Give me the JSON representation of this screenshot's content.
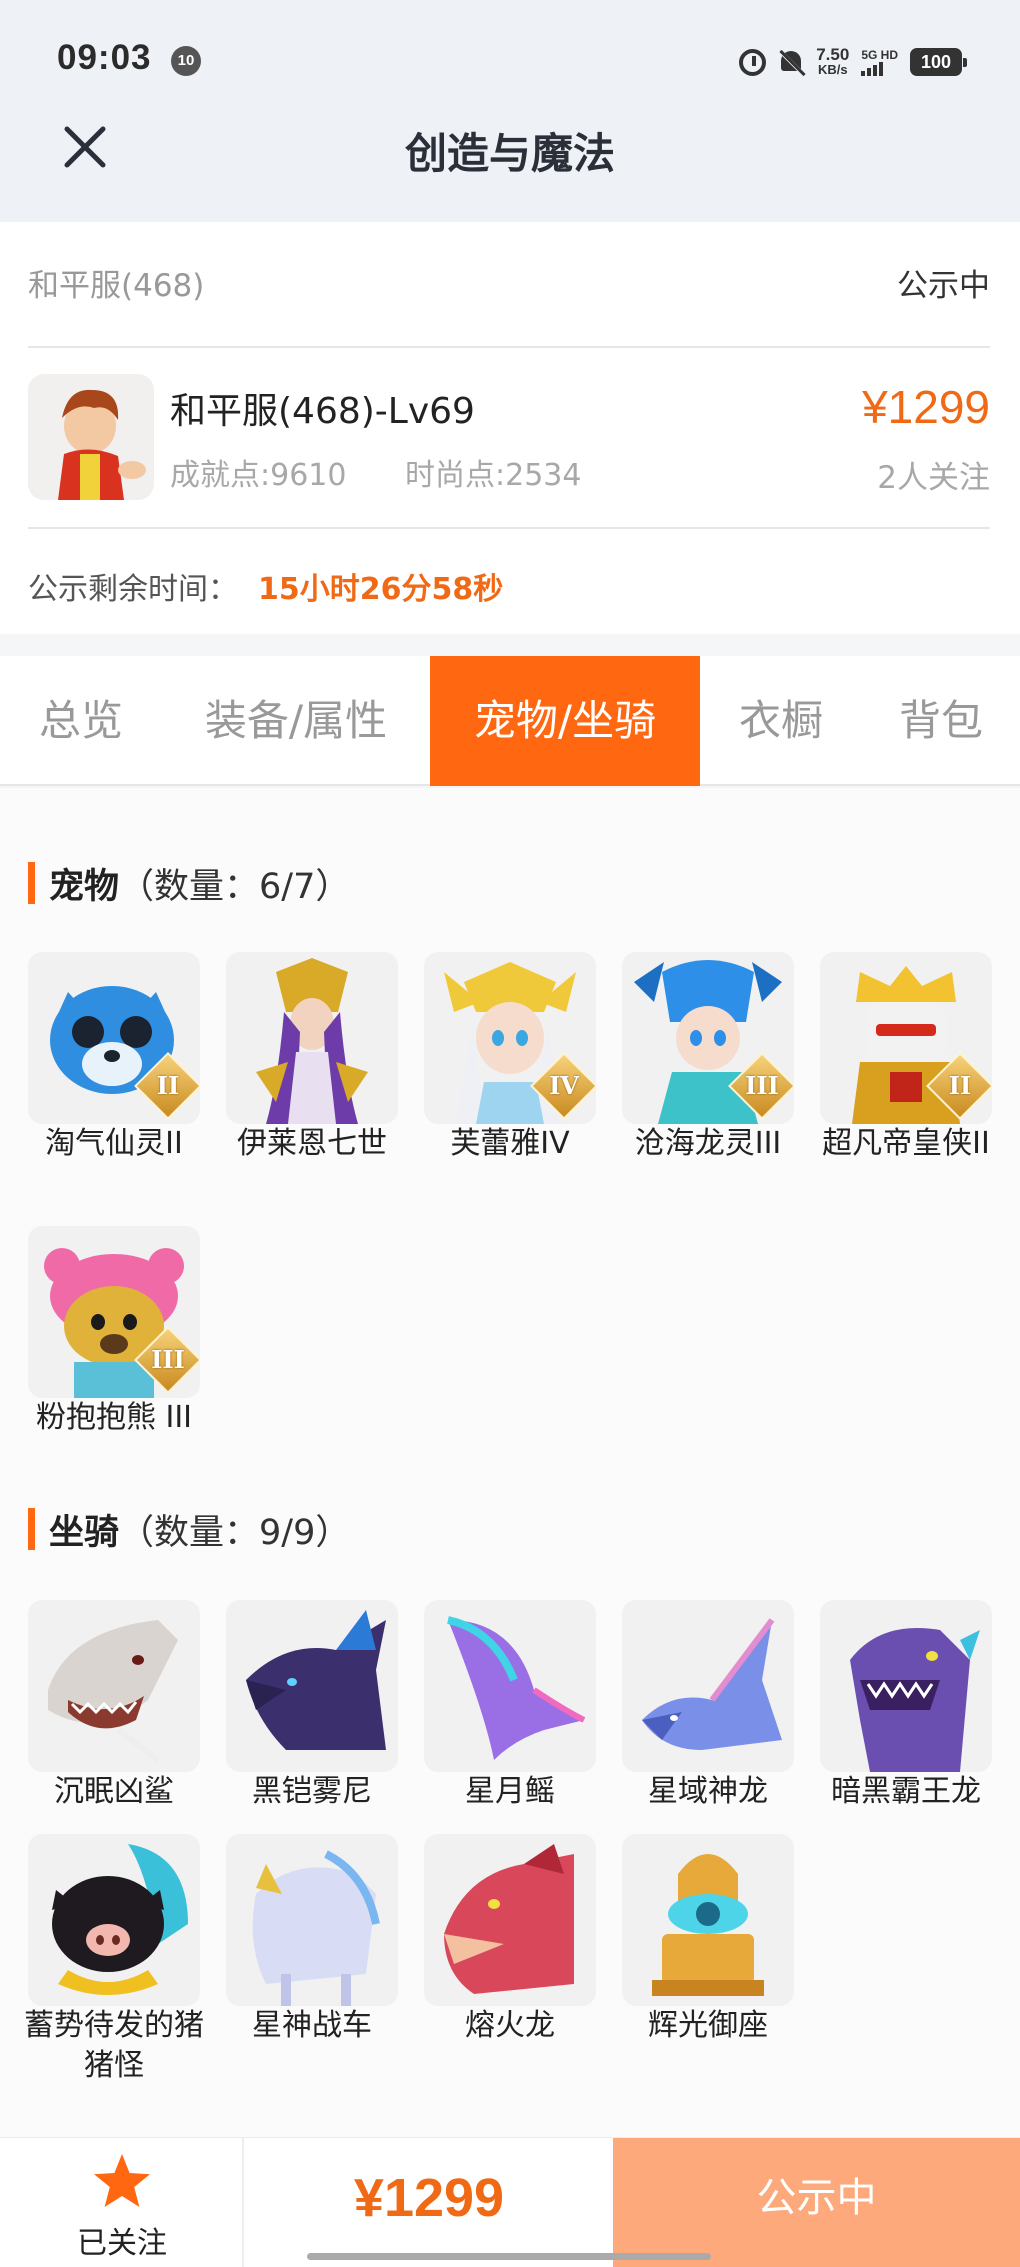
{
  "status_bar": {
    "time": "09:03",
    "badge": "10",
    "speed_value": "7.50",
    "speed_unit": "KB/s",
    "network": "5G HD",
    "battery": "100"
  },
  "header": {
    "title": "创造与魔法"
  },
  "card": {
    "server": "和平服(468)",
    "status": "公示中",
    "char_title": "和平服(468)-Lv69",
    "achievement": "成就点:9610",
    "fashion": "时尚点:2534",
    "price": "¥1299",
    "watchers": "2人关注",
    "remain_label": "公示剩余时间：",
    "remain_value": "15小时26分58秒"
  },
  "tabs": [
    "总览",
    "装备/属性",
    "宠物/坐骑",
    "衣橱",
    "背包"
  ],
  "active_tab": "宠物/坐骑",
  "pets": {
    "title": "宠物",
    "count": "（数量：6/7）",
    "items": [
      {
        "label": "淘气仙灵II",
        "tier": "II"
      },
      {
        "label": "伊莱恩七世",
        "tier": ""
      },
      {
        "label": "芙蕾雅IV",
        "tier": "IV"
      },
      {
        "label": "沧海龙灵III",
        "tier": "III"
      },
      {
        "label": "超凡帝皇侠II",
        "tier": "II"
      },
      {
        "label": "粉抱抱熊 III",
        "tier": "III"
      }
    ]
  },
  "mounts": {
    "title": "坐骑",
    "count": "（数量：9/9）",
    "items": [
      {
        "label": "沉眠凶鲨"
      },
      {
        "label": "黑铠雾尼"
      },
      {
        "label": "星月鳐"
      },
      {
        "label": "星域神龙"
      },
      {
        "label": "暗黑霸王龙"
      },
      {
        "label": "蓄势待发的猪猪怪"
      },
      {
        "label": "星神战车"
      },
      {
        "label": "熔火龙"
      },
      {
        "label": "辉光御座"
      }
    ]
  },
  "bottom": {
    "follow_label": "已关注",
    "price": "¥1299",
    "action": "公示中"
  },
  "colors": {
    "accent": "#ff6711",
    "price": "#f06a16",
    "action_bg": "#fda97c"
  }
}
